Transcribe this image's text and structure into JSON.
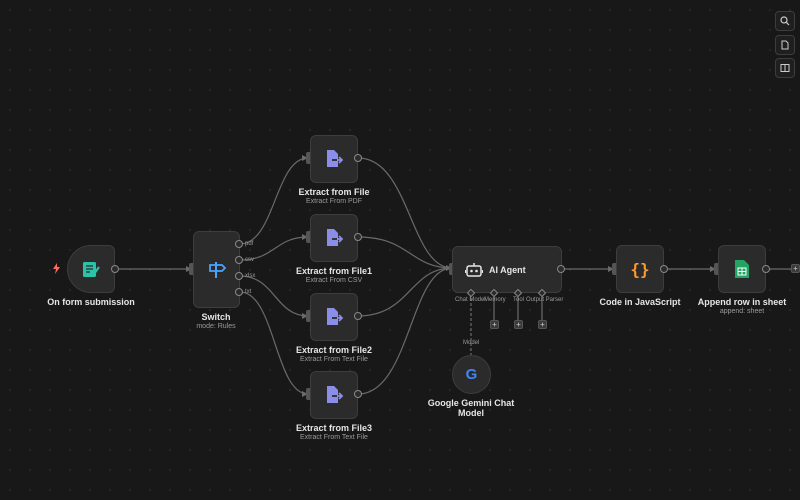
{
  "nodes": {
    "form": {
      "title": "On form submission"
    },
    "switch": {
      "title": "Switch",
      "subtitle": "mode: Rules",
      "outputs": [
        "pdf",
        "csv",
        "xlsx",
        "txt"
      ]
    },
    "extract": {
      "title": "Extract from File",
      "subtitle": "Extract From PDF"
    },
    "extract1": {
      "title": "Extract from File1",
      "subtitle": "Extract From CSV"
    },
    "extract2": {
      "title": "Extract from File2",
      "subtitle": "Extract From Text File"
    },
    "extract3": {
      "title": "Extract from File3",
      "subtitle": "Extract From Text File"
    },
    "agent": {
      "title": "AI Agent",
      "ports": [
        "Chat Model",
        "Memory",
        "Tool",
        "Output Parser"
      ]
    },
    "code": {
      "title": "Code in JavaScript"
    },
    "sheet": {
      "title": "Append row in sheet",
      "subtitle": "append: sheet"
    },
    "gemini": {
      "title_line1": "Google Gemini Chat",
      "title_line2": "Model",
      "connector": "Model"
    }
  },
  "toolbar": {
    "plus": "+"
  },
  "colors": {
    "trigger": "#ff6d5a",
    "form_icon": "#2ac3a7",
    "switch_icon": "#4aa3ff",
    "extract_icon": "#8a8ee8",
    "code_icon": "#ff9a2e",
    "sheet_icon": "#21a464"
  }
}
